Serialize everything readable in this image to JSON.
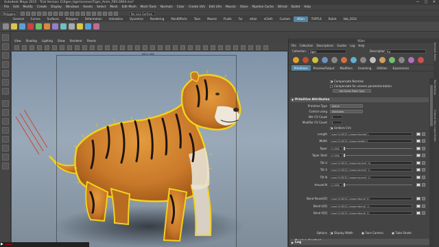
{
  "window": {
    "title": "Autodesk Maya 2015 - Trial Version: E\\Xgen_tiger\\scenes\\Tiger_Anim_FBX.0004.ma*",
    "controls": [
      "—",
      "▢",
      "✕"
    ]
  },
  "menubar": [
    "File",
    "Edit",
    "Modify",
    "Create",
    "Display",
    "Windows",
    "Assets",
    "Select",
    "Mesh",
    "Edit Mesh",
    "Mesh Tools",
    "Normals",
    "Color",
    "Create UVs",
    "Edit UVs",
    "Muscle",
    "XGen",
    "Pipeline Cache",
    "Bifrost",
    "Bullet",
    "Help"
  ],
  "statusline": {
    "mode": "Polygons",
    "live_surface": "No Live Surface"
  },
  "shelf": {
    "tabs": [
      "General",
      "Curves",
      "Surfaces",
      "Polygons",
      "Deformation",
      "Animation",
      "Dynamics",
      "Rendering",
      "PaintEffects",
      "Toon",
      "Muscle",
      "Fluids",
      "Fur",
      "nHair",
      "nCloth",
      "Custom",
      "XGen",
      "TURTLE",
      "Bullet",
      "Vab_2014"
    ],
    "active_tab": "XGen"
  },
  "viewport": {
    "menu": [
      "View",
      "Shading",
      "Lighting",
      "Show",
      "Renderer",
      "Panels"
    ],
    "camera_label": "640 x 360"
  },
  "attribute_editor": {
    "title": "XGen",
    "menu": [
      "File",
      "Collection",
      "Descriptions",
      "Guides",
      "Log",
      "Help"
    ],
    "collection_label": "Collection",
    "collection_value": "tiger",
    "description_label": "Description",
    "description_value": "fur",
    "tabs": [
      "Primitives",
      "Preview/Output",
      "Modifiers",
      "Grooming",
      "Utilities",
      "Expressions"
    ],
    "active_tab": "Primitives",
    "checkboxes": [
      {
        "label": "Compensate Normals",
        "checked": true
      },
      {
        "label": "Compensate for uneven parameterization",
        "checked": false
      }
    ],
    "small_button": "Set Guide Patch Type",
    "primitive_section": "Primitive Attributes",
    "dropdowns": [
      {
        "label": "Primitive Type",
        "value": "Spline"
      },
      {
        "label": "Control using",
        "value": "Attributes"
      }
    ],
    "numbers": [
      {
        "label": "Attr CV Count",
        "value": "5"
      },
      {
        "label": "Modifier CV Count",
        "value": "5"
      }
    ],
    "uniform_cvs": "Uniform CVs",
    "expressions": [
      {
        "label": "Length",
        "value": "map('${DESC}/groom/length/')"
      },
      {
        "label": "Width",
        "value": "map('${DESC}/groom/width/')"
      },
      {
        "label": "Taper",
        "value": "0.0000"
      },
      {
        "label": "Taper Start",
        "value": "0.0000"
      },
      {
        "label": "Tilt U",
        "value": "map('${DESC}/groom/orient/',0)"
      },
      {
        "label": "Tilt V",
        "value": "map('${DESC}/groom/orient/',1)"
      },
      {
        "label": "Tilt N",
        "value": "map('${DESC}/groom/orient/',2)"
      },
      {
        "label": "Around N",
        "value": "0.0000"
      },
      {
        "label": "Bend Param[0]",
        "value": "map('${DESC}/groom/bend/',0)"
      },
      {
        "label": "Bend U[0]",
        "value": "map('${DESC}/groom/bend/',1)"
      },
      {
        "label": "Bend V[0]",
        "value": "map('${DESC}/groom/bend/',2)"
      }
    ],
    "options_label": "Options",
    "options": [
      {
        "label": "Display Width",
        "checked": true
      },
      {
        "label": "Face Camera",
        "checked": true
      },
      {
        "label": "Tube Shade",
        "checked": true
      }
    ],
    "region_section": "Region Control",
    "log_section": "Log"
  },
  "side_tabs": [
    "Attribute Editor",
    "Tool Settings",
    "Channel Box / Layer Editor"
  ],
  "video": {
    "progress": 0.08
  }
}
